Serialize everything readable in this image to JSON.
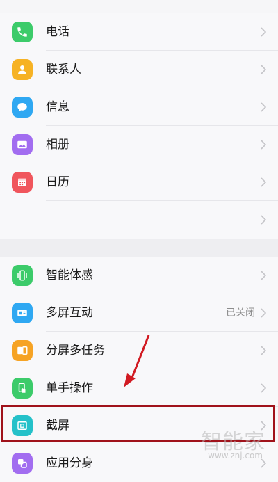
{
  "settings": {
    "group1": [
      {
        "label": "电话",
        "icon": "phone-icon",
        "color": "#3ccb6a"
      },
      {
        "label": "联系人",
        "icon": "contacts-icon",
        "color": "#f6b224"
      },
      {
        "label": "信息",
        "icon": "messages-icon",
        "color": "#2fa8f2"
      },
      {
        "label": "相册",
        "icon": "gallery-icon",
        "color": "#a26df0"
      },
      {
        "label": "日历",
        "icon": "calendar-icon",
        "color": "#f0555c"
      },
      {
        "label": "",
        "icon": "",
        "color": ""
      }
    ],
    "group2": [
      {
        "label": "智能体感",
        "icon": "smart-motion-icon",
        "color": "#3ccb6a",
        "value": ""
      },
      {
        "label": "多屏互动",
        "icon": "multi-screen-icon",
        "color": "#2fa8f2",
        "value": "已关闭"
      },
      {
        "label": "分屏多任务",
        "icon": "split-screen-icon",
        "color": "#f6a324",
        "value": ""
      },
      {
        "label": "单手操作",
        "icon": "one-hand-icon",
        "color": "#3ccb6a",
        "value": ""
      },
      {
        "label": "截屏",
        "icon": "screenshot-icon",
        "color": "#25c1c9",
        "value": ""
      },
      {
        "label": "应用分身",
        "icon": "app-clone-icon",
        "color": "#a26df0",
        "value": ""
      }
    ]
  },
  "watermark": {
    "text": "智能家",
    "url": "www.znj.com"
  }
}
